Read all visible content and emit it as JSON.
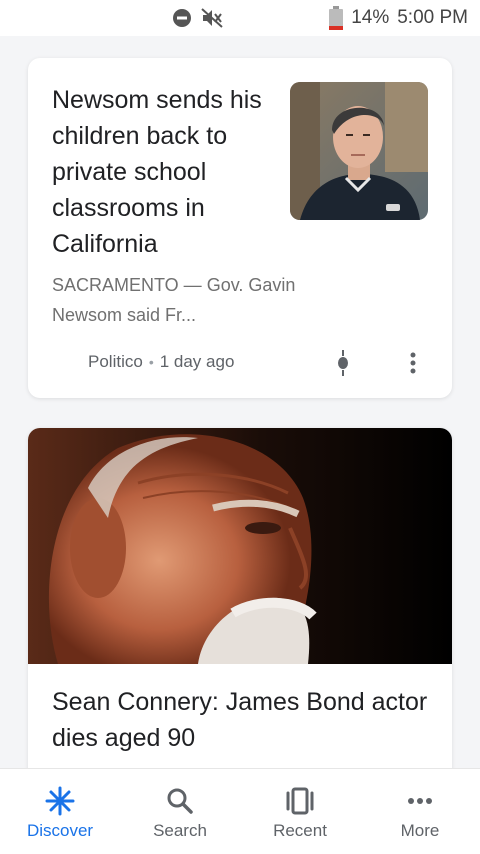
{
  "status_bar": {
    "battery": "14%",
    "time": "5:00 PM"
  },
  "cards": [
    {
      "headline": "Newsom sends his children back to private school classrooms in California",
      "snippet": "SACRAMENTO — Gov. Gavin Newsom said Fr...",
      "source": "Politico",
      "separator": "•",
      "age": "1 day ago"
    },
    {
      "headline": "Sean Connery: James Bond actor dies aged 90"
    }
  ],
  "bottom_nav": {
    "items": [
      {
        "label": "Discover",
        "icon": "asterisk-icon"
      },
      {
        "label": "Search",
        "icon": "search-icon"
      },
      {
        "label": "Recent",
        "icon": "recent-cards-icon"
      },
      {
        "label": "More",
        "icon": "more-horizontal-icon"
      }
    ]
  },
  "colors": {
    "accent": "#1a73e8",
    "battery_low": "#d93025"
  }
}
